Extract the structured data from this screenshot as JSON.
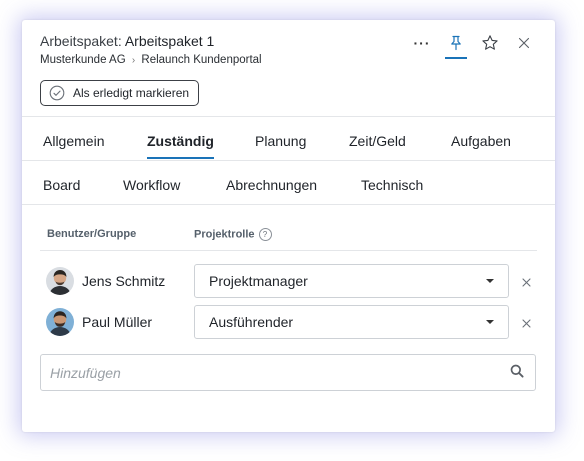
{
  "header": {
    "type_label": "Arbeitspaket:",
    "item_name": "Arbeitspaket 1",
    "breadcrumb": {
      "customer": "Musterkunde AG",
      "separator": "›",
      "project": "Relaunch Kundenportal"
    },
    "more_label": "···",
    "mark_done_label": "Als erledigt markieren"
  },
  "tabs_row1": [
    "Allgemein",
    "Zuständig",
    "Planung",
    "Zeit/Geld",
    "Aufgaben"
  ],
  "tabs_row2": [
    "Board",
    "Workflow",
    "Abrechnungen",
    "Technisch"
  ],
  "active_tab": "Zuständig",
  "table": {
    "col_user": "Benutzer/Gruppe",
    "col_role": "Projektrolle",
    "help_glyph": "?",
    "rows": [
      {
        "user": "Jens Schmitz",
        "role": "Projektmanager"
      },
      {
        "user": "Paul Müller",
        "role": "Ausführender"
      }
    ]
  },
  "add": {
    "placeholder": "Hinzufügen"
  },
  "colors": {
    "accent": "#1a73b8",
    "text": "#1f2329",
    "border": "#cdd1d6",
    "glow": "#6e6edc"
  },
  "icons": [
    "more-icon",
    "pin-icon",
    "star-icon",
    "close-icon",
    "check-circle-icon",
    "help-icon",
    "caret-down-icon",
    "remove-icon",
    "search-icon"
  ]
}
